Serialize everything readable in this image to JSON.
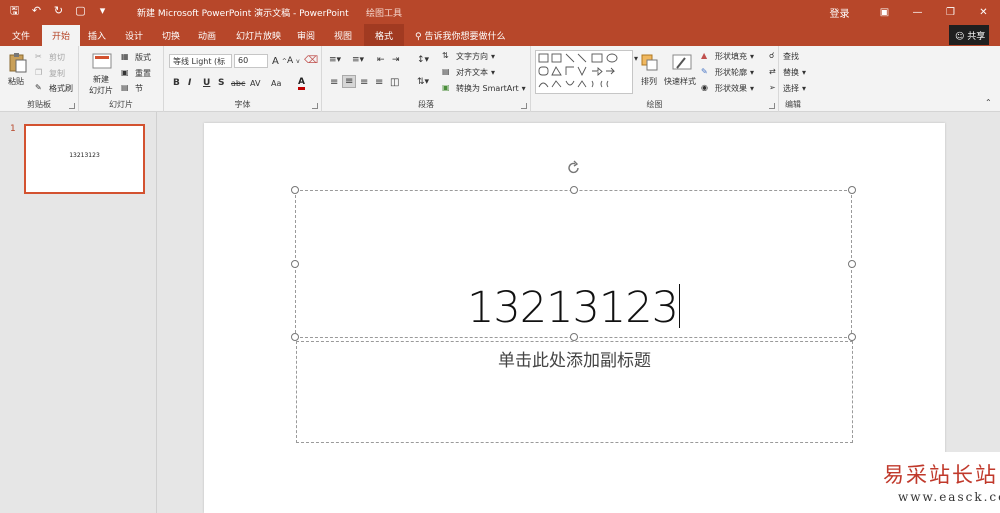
{
  "titlebar": {
    "doc_title": "新建 Microsoft PowerPoint 演示文稿 - PowerPoint",
    "context_title": "绘图工具",
    "login": "登录"
  },
  "tabs": {
    "items": [
      "文件",
      "开始",
      "插入",
      "设计",
      "切换",
      "动画",
      "幻灯片放映",
      "审阅",
      "视图",
      "格式"
    ],
    "active": "开始",
    "tell_me": "告诉我你想要做什么",
    "share": "共享"
  },
  "ribbon": {
    "clipboard": {
      "label": "剪贴板",
      "paste": "粘贴",
      "cut": "剪切",
      "copy": "复制",
      "format_painter": "格式刷"
    },
    "slides": {
      "label": "幻灯片",
      "new_slide_1": "新建",
      "new_slide_2": "幻灯片",
      "layout": "版式",
      "reset": "重置",
      "section": "节"
    },
    "font": {
      "label": "字体",
      "font_name": "等线 Light (标",
      "font_size": "60",
      "bold": "B",
      "italic": "I",
      "underline": "U",
      "shadow": "S",
      "strike": "abc",
      "spacing": "AV",
      "case": "Aa",
      "color": "A"
    },
    "paragraph": {
      "label": "段落",
      "text_direction": "文字方向",
      "align_text": "对齐文本",
      "smartart": "转换为 SmartArt"
    },
    "drawing": {
      "label": "绘图",
      "arrange": "排列",
      "quick_styles": "快速样式",
      "shape_fill": "形状填充",
      "shape_outline": "形状轮廓",
      "shape_effects": "形状效果"
    },
    "editing": {
      "label": "编辑",
      "find": "查找",
      "replace": "替换",
      "select": "选择"
    }
  },
  "thumbnails": {
    "number": "1",
    "text": "13213123"
  },
  "slide": {
    "title": "13213123",
    "subtitle": "单击此处添加副标题"
  },
  "watermark": {
    "line1": "易采站长站",
    "line2": "www.easck.com"
  },
  "colors": {
    "accent": "#b7472a",
    "ribbon_bg": "#f3f3f3",
    "workspace_bg": "#e6e6e6",
    "watermark_red": "#c0392b"
  }
}
